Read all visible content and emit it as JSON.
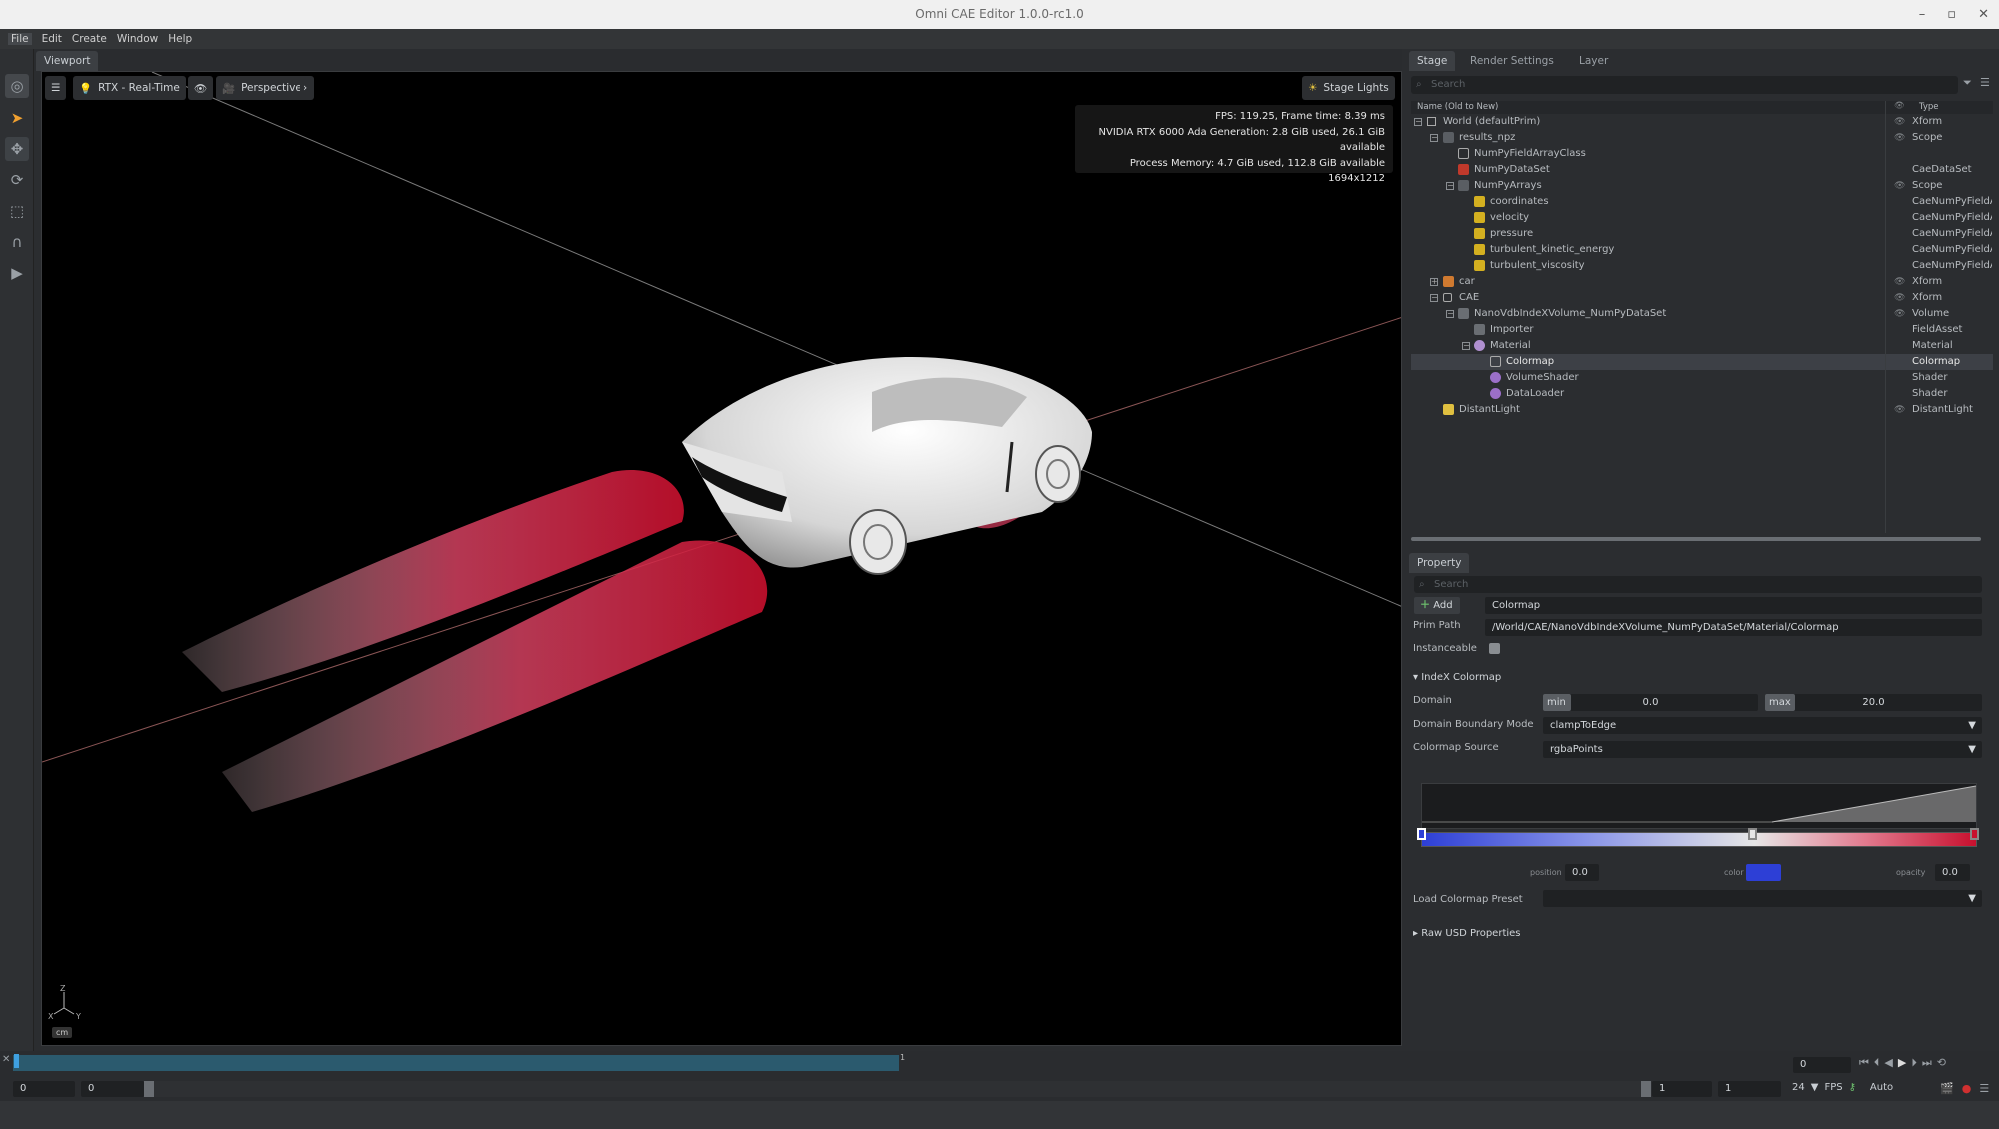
{
  "window": {
    "title": "Omni CAE Editor 1.0.0-rc1.0",
    "controls": [
      "–",
      "▫",
      "✕"
    ]
  },
  "menu": [
    "File",
    "Edit",
    "Create",
    "Window",
    "Help"
  ],
  "viewport": {
    "tab": "Viewport",
    "renderer": "RTX - Real-Time",
    "camera": "Perspective",
    "lights": "Stage Lights",
    "stats": [
      "FPS: 119.25, Frame time: 8.39 ms",
      "NVIDIA RTX 6000 Ada Generation: 2.8 GiB used, 26.1 GiB available",
      "Process Memory: 4.7 GiB used, 112.8 GiB available",
      "1694x1212"
    ],
    "axis_labels": {
      "z": "Z",
      "x": "X",
      "y": "Y"
    },
    "unit": "cm"
  },
  "stage": {
    "tabs": [
      "Stage",
      "Render Settings",
      "Layer"
    ],
    "search_placeholder": "Search",
    "col_name": "Name (Old to New)",
    "col_type": "Type",
    "rows": [
      {
        "name": "World (defaultPrim)",
        "type": "Xform"
      },
      {
        "name": "results_npz",
        "type": "Scope"
      },
      {
        "name": "NumPyFieldArrayClass",
        "type": ""
      },
      {
        "name": "NumPyDataSet",
        "type": "CaeDataSet"
      },
      {
        "name": "NumPyArrays",
        "type": "Scope"
      },
      {
        "name": "coordinates",
        "type": "CaeNumPyFieldArray"
      },
      {
        "name": "velocity",
        "type": "CaeNumPyFieldArray"
      },
      {
        "name": "pressure",
        "type": "CaeNumPyFieldArray"
      },
      {
        "name": "turbulent_kinetic_energy",
        "type": "CaeNumPyFieldArray"
      },
      {
        "name": "turbulent_viscosity",
        "type": "CaeNumPyFieldArray"
      },
      {
        "name": "car",
        "type": "Xform"
      },
      {
        "name": "CAE",
        "type": "Xform"
      },
      {
        "name": "NanoVdbIndeXVolume_NumPyDataSet",
        "type": "Volume"
      },
      {
        "name": "Importer",
        "type": "FieldAsset"
      },
      {
        "name": "Material",
        "type": "Material"
      },
      {
        "name": "Colormap",
        "type": "Colormap"
      },
      {
        "name": "VolumeShader",
        "type": "Shader"
      },
      {
        "name": "DataLoader",
        "type": "Shader"
      },
      {
        "name": "DistantLight",
        "type": "DistantLight"
      }
    ]
  },
  "property": {
    "tab": "Property",
    "search_placeholder": "Search",
    "add_label": "Add",
    "prim_name": "Colormap",
    "prim_path_label": "Prim Path",
    "prim_path": "/World/CAE/NanoVdbIndeXVolume_NumPyDataSet/Material/Colormap",
    "instanceable_label": "Instanceable",
    "section_colormap": "IndeX Colormap",
    "domain_label": "Domain",
    "domain_min_tag": "min",
    "domain_min": "0.0",
    "domain_max_tag": "max",
    "domain_max": "20.0",
    "boundary_label": "Domain Boundary Mode",
    "boundary_value": "clampToEdge",
    "source_label": "Colormap Source",
    "source_value": "rgbaPoints",
    "position_label": "position",
    "position_value": "0.0",
    "color_label": "color",
    "opacity_label": "opacity",
    "opacity_value": "0.0",
    "preset_label": "Load Colormap Preset",
    "section_raw": "Raw USD Properties",
    "colors": {
      "blue": "#2d3fd6",
      "red": "#c8102e",
      "mid": "#e6e6e6"
    }
  },
  "timeline": {
    "marker": "1",
    "current": "0",
    "start": "0",
    "start2": "0",
    "end1": "1",
    "end2": "1",
    "fps": "24",
    "fps_label": "FPS",
    "mode": "Auto"
  }
}
